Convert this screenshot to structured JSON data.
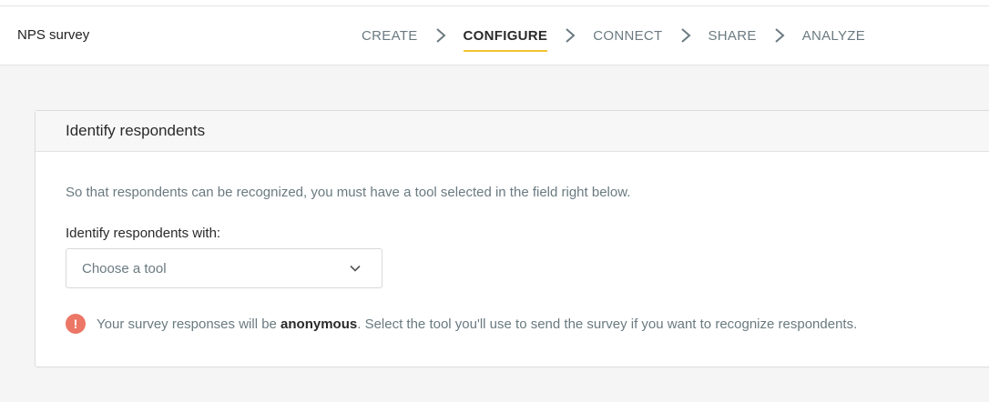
{
  "header": {
    "survey_name": "NPS survey",
    "steps": [
      {
        "label": "CREATE"
      },
      {
        "label": "CONFIGURE",
        "active": true
      },
      {
        "label": "CONNECT"
      },
      {
        "label": "SHARE"
      },
      {
        "label": "ANALYZE"
      }
    ]
  },
  "identify": {
    "title": "Identify respondents",
    "description": "So that respondents can be recognized, you must have a tool selected in the field right below.",
    "field_label": "Identify respondents with:",
    "select_placeholder": "Choose a tool",
    "notice_prefix": "Your survey responses will be ",
    "notice_bold": "anonymous",
    "notice_suffix": ". Select the tool you'll use to send the survey if you want to recognize respondents."
  },
  "colors": {
    "accent": "#f2c230",
    "alert": "#ec7766"
  },
  "icons": {
    "step_separator": "chevron-right-icon",
    "select_arrow": "chevron-down-icon",
    "notice": "exclamation-icon"
  }
}
